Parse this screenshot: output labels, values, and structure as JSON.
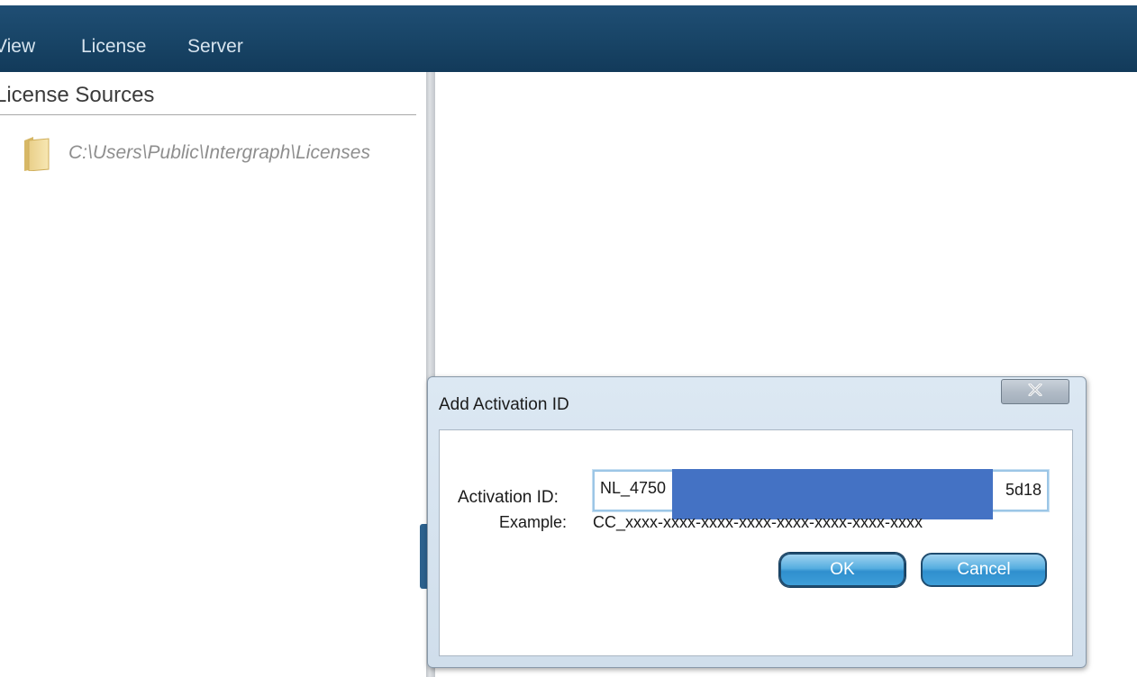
{
  "menubar": {
    "items": [
      "View",
      "License",
      "Server"
    ]
  },
  "left_panel": {
    "title": "License Sources",
    "sources": [
      {
        "path": "C:\\Users\\Public\\Intergraph\\Licenses",
        "icon": "folder-icon"
      }
    ]
  },
  "dialog": {
    "title": "Add Activation ID",
    "close_label": "x",
    "activation_label": "Activation ID:",
    "activation_value_start": "NL_4750",
    "activation_value_end": "5d18",
    "example_label": "Example:",
    "example_value": "CC_xxxx-xxxx-xxxx-xxxx-xxxx-xxxx-xxxx-xxxx",
    "ok_label": "OK",
    "cancel_label": "Cancel"
  },
  "colors": {
    "menubar": "#184466",
    "redaction": "#4472c4",
    "button": "#3e9fd9"
  }
}
